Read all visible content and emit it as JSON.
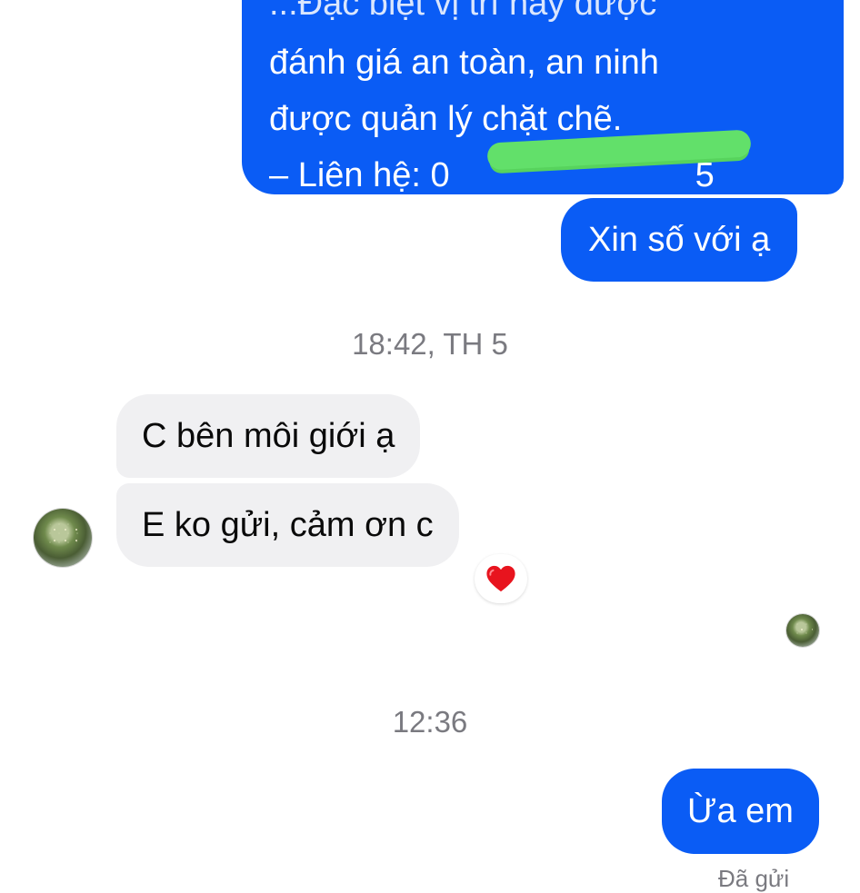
{
  "conversation": {
    "outgoing_top": {
      "lines": [
        "...Đặc biệt vị trí này được",
        "đánh giá an toàn, an ninh",
        "được quản lý chặt chẽ.",
        "– Liên hệ: 0",
        "5"
      ],
      "redaction_color": "#62e06a"
    },
    "outgoing_request": "Xin số với ạ",
    "timestamp_1": "18:42, TH 5",
    "incoming_1": "C bên môi giới ạ",
    "incoming_2": "E ko gửi, cảm ơn c",
    "reaction": "heart",
    "timestamp_2": "12:36",
    "outgoing_reply": "Ừa em",
    "delivery_status": "Đã gửi"
  },
  "colors": {
    "outgoing_bubble": "#0a5cf5",
    "incoming_bubble": "#f0f0f2",
    "timestamp_text": "#7a7a80",
    "heart": "#e8141e"
  },
  "icons": {
    "avatar": "contact-avatar",
    "reaction": "heart-icon"
  }
}
